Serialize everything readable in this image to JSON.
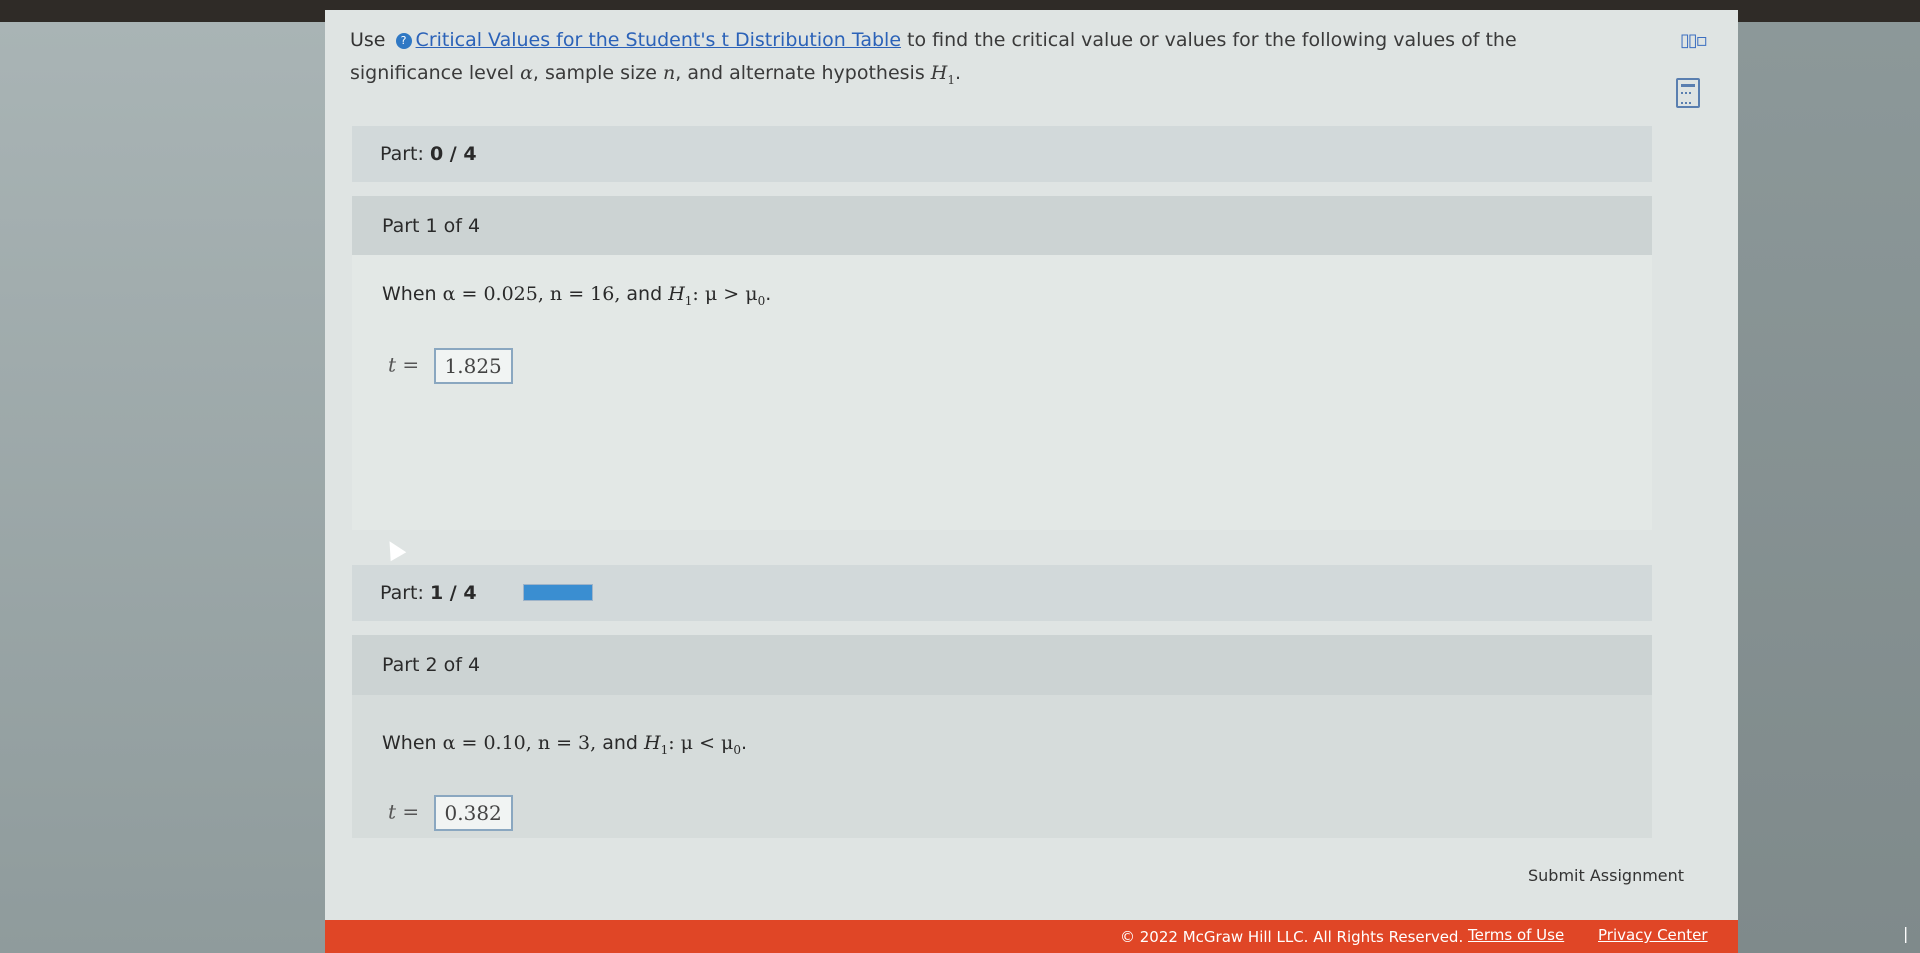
{
  "instructions": {
    "use": "Use",
    "link_text": "Critical Values for the Student's t Distribution Table",
    "text_1": " to find the critical value or values for the following values of the",
    "text_2": "significance level ",
    "alpha": "α",
    "text_3": ", sample size ",
    "n": "n",
    "text_4": ", and alternate hypothesis ",
    "H": "H",
    "H_sub": "1",
    "text_end": "."
  },
  "progress_top": {
    "label": "Part:",
    "value": "0 / 4",
    "fraction": 0.0
  },
  "part1": {
    "title": "Part 1 of 4",
    "q_when": "When ",
    "q_alpha": "α = 0.025, n = 16,",
    "q_and": " and ",
    "q_H": "H",
    "q_H_sub": "1",
    "q_rel": ": μ > μ",
    "q_mu_sub": "0",
    "q_end": ".",
    "t_label": "t =",
    "answer": "1.825"
  },
  "progress_mid": {
    "label": "Part:",
    "value": "1 / 4",
    "fraction": 1.0
  },
  "part2": {
    "title": "Part 2 of 4",
    "q_when": "When ",
    "q_alpha": "α = 0.10, n = 3,",
    "q_and": " and ",
    "q_H": "H",
    "q_H_sub": "1",
    "q_rel": ": μ < μ",
    "q_mu_sub": "0",
    "q_end": ".",
    "t_label": "t =",
    "answer": "0.382"
  },
  "submit": "Submit Assignment",
  "footer": {
    "copyright": "© 2022 McGraw Hill LLC. All Rights Reserved.",
    "terms": "Terms of Use",
    "separator": "|",
    "privacy": "Privacy Center"
  },
  "icons": [
    "table-icon",
    "calculator-icon"
  ],
  "colors": {
    "accent": "#2b62b8",
    "progress": "#3a8ed1",
    "footer": "#e04626"
  }
}
